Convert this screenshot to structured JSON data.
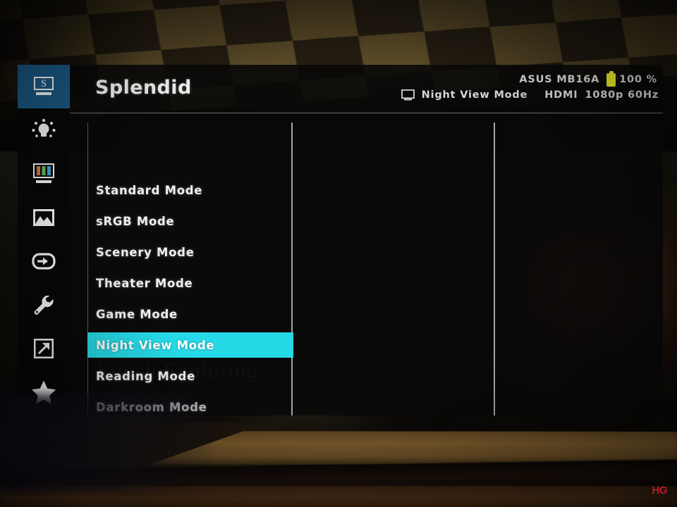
{
  "device": {
    "brand_model": "ASUS MB16A",
    "battery_percent": "100 %",
    "source": "HDMI",
    "resolution_refresh": "1080p 60Hz",
    "current_mode": "Night View Mode"
  },
  "osd": {
    "title": "Splendid",
    "colors": {
      "sidebar_active": "#1b5b87",
      "selection": "#26d9e6",
      "battery": "#e9e92b",
      "text": "#f0f0f0",
      "panel": "#090909"
    },
    "sidebar": [
      {
        "icon": "splendid-monitor-s-icon",
        "name": "splendid",
        "active": true
      },
      {
        "icon": "brightness-bulb-icon",
        "name": "blue-light-filter",
        "active": false
      },
      {
        "icon": "color-bars-monitor-icon",
        "name": "color",
        "active": false
      },
      {
        "icon": "picture-image-icon",
        "name": "image",
        "active": false
      },
      {
        "icon": "input-select-icon",
        "name": "input-select",
        "active": false
      },
      {
        "icon": "wrench-icon",
        "name": "system-setup",
        "active": false
      },
      {
        "icon": "shortcut-arrow-icon",
        "name": "shortcut",
        "active": false
      },
      {
        "icon": "star-icon",
        "name": "myfavorite",
        "active": false
      }
    ],
    "menu_items": [
      {
        "label": "Standard Mode",
        "selected": false
      },
      {
        "label": "sRGB Mode",
        "selected": false
      },
      {
        "label": "Scenery Mode",
        "selected": false
      },
      {
        "label": "Theater Mode",
        "selected": false
      },
      {
        "label": "Game Mode",
        "selected": false
      },
      {
        "label": "Night View Mode",
        "selected": true
      },
      {
        "label": "Reading Mode",
        "selected": false
      },
      {
        "label": "Darkroom Mode",
        "selected": false
      }
    ]
  },
  "background": {
    "scene_text": "Finish Exploring"
  },
  "watermark": {
    "text": "HG"
  }
}
